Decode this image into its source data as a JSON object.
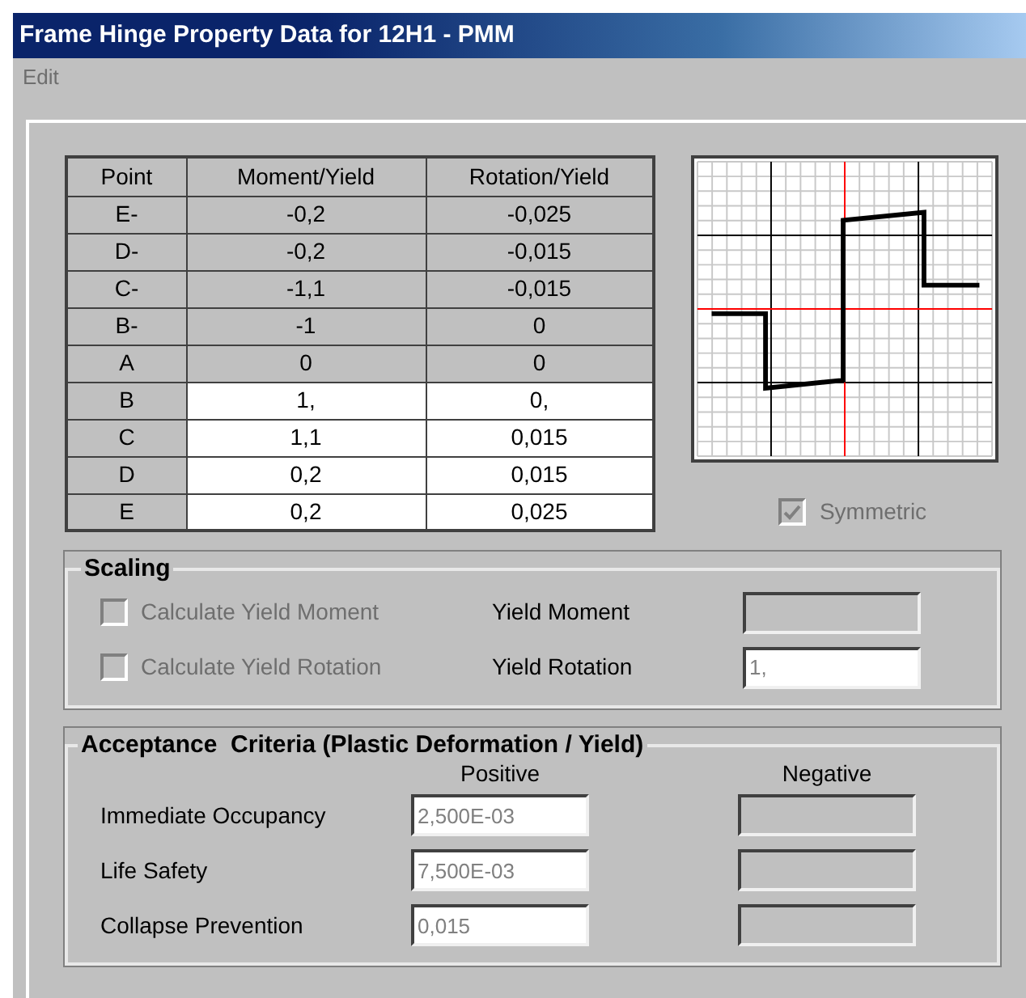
{
  "window": {
    "title": "Frame Hinge Property Data for 12H1 - PMM"
  },
  "menu": [
    {
      "label": "Edit",
      "disabled": true
    }
  ],
  "table": {
    "columns": [
      "Point",
      "Moment/Yield",
      "Rotation/Yield"
    ],
    "rows": [
      {
        "cells": [
          "E-",
          "-0,2",
          "-0,025"
        ],
        "disabled": true
      },
      {
        "cells": [
          "D-",
          "-0,2",
          "-0,015"
        ],
        "disabled": true
      },
      {
        "cells": [
          "C-",
          "-1,1",
          "-0,015"
        ],
        "disabled": true
      },
      {
        "cells": [
          "B-",
          "-1",
          "0"
        ],
        "disabled": true
      },
      {
        "cells": [
          "A",
          "0",
          "0"
        ],
        "disabled": true
      },
      {
        "cells": [
          "B",
          "1,",
          "0,"
        ],
        "disabled": false
      },
      {
        "cells": [
          "C",
          "1,1",
          "0,015"
        ],
        "disabled": false
      },
      {
        "cells": [
          "D",
          "0,2",
          "0,015"
        ],
        "disabled": false
      },
      {
        "cells": [
          "E",
          "0,2",
          "0,025"
        ],
        "disabled": false
      }
    ]
  },
  "symmetric": {
    "label": "Symmetric",
    "checked": true,
    "disabled": true
  },
  "scaling": {
    "title": "Scaling",
    "rows": [
      {
        "checkbox": {
          "label": "Calculate Yield Moment",
          "checked": false,
          "disabled": true
        },
        "label": "Yield Moment",
        "field": {
          "disabled": true
        }
      },
      {
        "checkbox": {
          "label": "Calculate Yield Rotation",
          "checked": false,
          "disabled": true
        },
        "label": "Yield Rotation",
        "field": {
          "value": "1,",
          "disabled": false
        }
      }
    ]
  },
  "acceptance": {
    "title": "Acceptance  Criteria (Plastic Deformation / Yield)",
    "positive_header": "Positive",
    "negative_header": "Negative",
    "rows": [
      {
        "label": "Immediate Occupancy",
        "positive": {
          "value": "2,500E-03",
          "disabled": false
        },
        "negative": {
          "disabled": true
        }
      },
      {
        "label": "Life Safety",
        "positive": {
          "value": "7,500E-03",
          "disabled": false
        },
        "negative": {
          "disabled": true
        }
      },
      {
        "label": "Collapse Prevention",
        "positive": {
          "value": "0,015",
          "disabled": false
        },
        "negative": {
          "disabled": true
        }
      }
    ]
  }
}
